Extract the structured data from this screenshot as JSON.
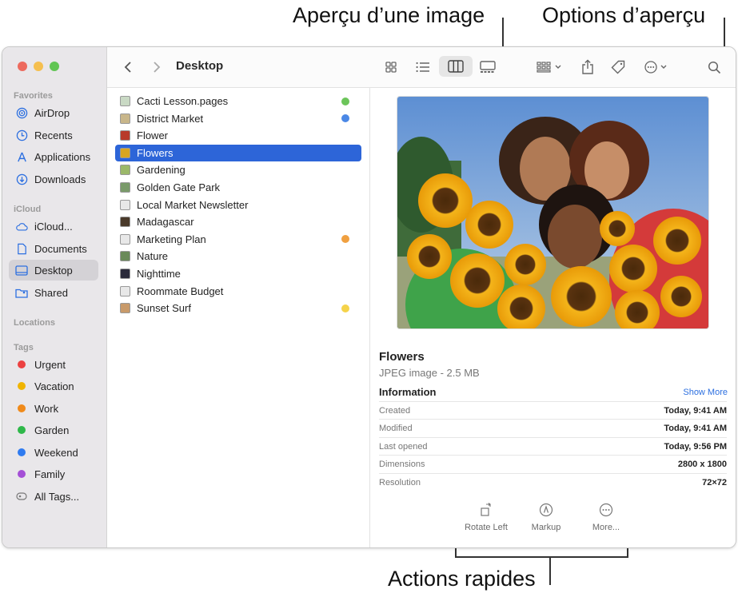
{
  "callouts": {
    "preview_image": "Aperçu d’une image",
    "preview_options": "Options d’aperçu",
    "quick_actions": "Actions rapides"
  },
  "colors": {
    "accent": "#2d65d8",
    "close": "#ed6a5e",
    "minimize": "#f5bf4f",
    "zoom": "#61c554"
  },
  "toolbar": {
    "title": "Desktop",
    "icons": [
      "back-chevron-icon",
      "forward-chevron-icon",
      "icon-view-icon",
      "list-view-icon",
      "column-view-icon",
      "gallery-view-icon",
      "group-icon",
      "share-icon",
      "tag-icon",
      "more-actions-icon",
      "search-icon"
    ]
  },
  "sidebar": {
    "favorites_label": "Favorites",
    "favorites": [
      {
        "label": "AirDrop",
        "icon": "airdrop-icon"
      },
      {
        "label": "Recents",
        "icon": "clock-icon"
      },
      {
        "label": "Applications",
        "icon": "applications-icon"
      },
      {
        "label": "Downloads",
        "icon": "download-icon"
      }
    ],
    "icloud_label": "iCloud",
    "icloud": [
      {
        "label": "iCloud...",
        "icon": "cloud-icon"
      },
      {
        "label": "Documents",
        "icon": "document-icon"
      },
      {
        "label": "Desktop",
        "icon": "desktop-icon",
        "active": true
      },
      {
        "label": "Shared",
        "icon": "shared-folder-icon"
      }
    ],
    "locations_label": "Locations",
    "tags_label": "Tags",
    "tags": [
      {
        "label": "Urgent",
        "color": "#ec4141"
      },
      {
        "label": "Vacation",
        "color": "#f0b400"
      },
      {
        "label": "Work",
        "color": "#f08a1a"
      },
      {
        "label": "Garden",
        "color": "#2fb84a"
      },
      {
        "label": "Weekend",
        "color": "#2f7bf0"
      },
      {
        "label": "Family",
        "color": "#a44fd6"
      },
      {
        "label": "All Tags...",
        "color": ""
      }
    ]
  },
  "files": [
    {
      "name": "Cacti Lesson.pages",
      "tag": "#6cc55a"
    },
    {
      "name": "District Market",
      "tag": "#4b88e6"
    },
    {
      "name": "Flower",
      "tag": ""
    },
    {
      "name": "Flowers",
      "tag": "",
      "selected": true
    },
    {
      "name": "Gardening",
      "tag": ""
    },
    {
      "name": "Golden Gate Park",
      "tag": ""
    },
    {
      "name": "Local Market Newsletter",
      "tag": ""
    },
    {
      "name": "Madagascar",
      "tag": ""
    },
    {
      "name": "Marketing Plan",
      "tag": "#f0a040"
    },
    {
      "name": "Nature",
      "tag": ""
    },
    {
      "name": "Nighttime",
      "tag": ""
    },
    {
      "name": "Roommate Budget",
      "tag": ""
    },
    {
      "name": "Sunset Surf",
      "tag": "#f5d34a"
    }
  ],
  "preview": {
    "title": "Flowers",
    "subtitle": "JPEG image - 2.5 MB",
    "info_label": "Information",
    "show_more": "Show More",
    "meta": [
      {
        "k": "Created",
        "v": "Today, 9:41 AM"
      },
      {
        "k": "Modified",
        "v": "Today, 9:41 AM"
      },
      {
        "k": "Last opened",
        "v": "Today, 9:56 PM"
      },
      {
        "k": "Dimensions",
        "v": "2800 x 1800"
      },
      {
        "k": "Resolution",
        "v": "72×72"
      }
    ],
    "actions": [
      {
        "label": "Rotate Left",
        "icon": "rotate-left-icon"
      },
      {
        "label": "Markup",
        "icon": "markup-icon"
      },
      {
        "label": "More...",
        "icon": "more-icon"
      }
    ]
  }
}
